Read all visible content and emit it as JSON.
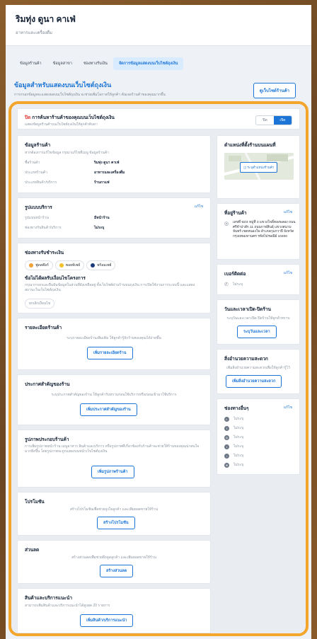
{
  "header": {
    "shop_name": "ริมทุ่ง ดูนา คาเฟ่",
    "shop_subtitle": "อาหารและเครื่องดื่ม"
  },
  "tabs": [
    {
      "label": "ข้อมูลร้านค้า"
    },
    {
      "label": "ข้อมูลสาขา"
    },
    {
      "label": "ช่องทางรับเงิน"
    },
    {
      "label": "จัดการข้อมูลแสดงบนเว็บไซต์ถุงเงิน",
      "active": true
    }
  ],
  "intro": {
    "title": "ข้อมูลสำหรับแสดงบนเว็บไซต์ถุงเงิน",
    "subtitle": "การกรอกข้อมูลจะแสดงผลบนเว็บไซต์ถุงเงิน จะช่วยเพิ่มโอกาสให้ลูกค้า ค้นเจอร้านค้าของคุณมากขึ้น",
    "preview_label": "ดูเว็บไซต์ร้านค้า"
  },
  "toggle": {
    "prefix": "ปิด",
    "title": "การค้นหาร้านค้าของคุณบนเว็บไซต์ถุงเงิน",
    "subtitle": "แสดงข้อมูลร้านค้าบนเว็บไซต์ถุงเงินให้ลูกค้าค้นหา",
    "off_label": "ปิด",
    "on_label": "เปิด"
  },
  "store_info": {
    "title": "ข้อมูลร้านค้า",
    "subtitle": "หากต้องการแก้ไขข้อมูล กรุณาแก้ไขที่เมนู ข้อมูลร้านค้า",
    "rows": [
      {
        "label": "ชื่อร้านค้า",
        "value": "ริมทุ่ง ดูนา คาเฟ่"
      },
      {
        "label": "ประเภทร้านค้า",
        "value": "อาหารและเครื่องดื่ม"
      },
      {
        "label": "ประเภทสินค้า/บริการ",
        "value": "ร้านกาแฟ"
      }
    ]
  },
  "service": {
    "title": "รูปแบบบริการ",
    "edit_label": "แก้ไข",
    "rows": [
      {
        "label": "รูปแบบหน้าร้าน",
        "value": "มีหน้าร้าน"
      },
      {
        "label": "ช่องทางรับสินค้า/บริการ",
        "value": "ไม่ระบุ"
      }
    ]
  },
  "payment": {
    "title": "ช่องทางรับชำระเงิน",
    "methods": [
      "ฟูดสต๊อร์",
      "พอยท์เพย์",
      "พร้อมเพย์"
    ],
    "conditions_title": "ข้อไม่ได้ผลรับเงื่อนไขโครงการ",
    "conditions_text": "กรุณากรอกและยืนยันข้อมูลในส่วนที่ยังเหลืออยู่ ทั้งเว็บไซต์ผ่านร้านบนถุงเงิน การเปิดใช้งานการระบบนี้ และแสดงสถานะในเว็บไซต์ถุงเงิน",
    "chip_label": "ยกเลิกเงื่อนไข"
  },
  "store_detail": {
    "title": "รายละเอียดร้านค้า",
    "hint": "ระบุรายละเอียดร้านเพิ่มเติม ให้ลูกค้ารู้จักร้านของคุณได้ง่ายขึ้น",
    "button": "เพิ่มรายละเอียดร้าน"
  },
  "announcement": {
    "title": "ประกาศสำคัญของร้าน",
    "hint": "ระบุประกาศสำคัญของร้าน ให้ลูกค้ารับทราบก่อนใช้บริการหรือก่อนเข้ามาใช้บริการ",
    "button": "เพิ่มประกาศสำคัญของร้าน"
  },
  "photos": {
    "title": "รูปภาพประกอบร้านค้า",
    "hint": "การเพิ่มรูปภาพหน้าร้าน เมนูอาหาร สินค้าและบริการ หรือรูปภาพที่เกี่ยวข้องกับร้านค้าจะช่วยให้ร้านของคุณน่าสนใจมากยิ่งขึ้น โดยรูปภาพจะถูกแสดงบนหน้าเว็บไซต์ถุงเงิน",
    "button": "เพิ่มรูปภาพร้านค้า"
  },
  "promo": {
    "title": "โปรโมชัน",
    "hint": "สร้างโปรโมชันเพื่อช่วยจูงใจลูกค้า และเพิ่มยอดขายให้ร้าน",
    "button": "สร้างโปรโมชัน"
  },
  "discount": {
    "title": "ส่วนลด",
    "hint": "สร้างส่วนลดเพื่อช่วยดึงดูดลูกค้า และเพิ่มยอดขายให้ร้าน",
    "button": "สร้างส่วนลด"
  },
  "recommend": {
    "title": "สินค้าและบริการแนะนำ",
    "hint": "สามารถเพิ่มสินค้าและบริการแนะนำได้สูงสุด 20 รายการ",
    "button": "เพิ่มสินค้า/บริการแนะนำ"
  },
  "map_card": {
    "title": "ตำแหน่งที่ตั้งร้านบนแผนที่",
    "button": "ระบุตำแหน่งร้านค้า"
  },
  "address": {
    "title": "ที่อยู่ร้านค้า",
    "edit_label": "แก้ไข",
    "text": "เลขที่ 92/4 หมู่ที่ 3 แขวงโพธิ์ทองพลอง ถนนศรีจำปาสัก 11 ถนนกาฬสินธุ์ แขวงสนามจันทร์ เขตหนองโพ อำเภอกุมภวาปี จังหวัดกรุงเทพมหานคร รหัสไปรษณีย์ 10400"
  },
  "phone": {
    "title": "เบอร์ติดต่อ",
    "edit_label": "แก้ไข",
    "value": "ไม่ระบุ"
  },
  "hours": {
    "title": "วันและเวลาเปิด-ปิดร้าน",
    "hint": "ระบุวันและเวลาเปิด-ปิดร้านให้ลูกค้าทราบ",
    "button": "ระบุวันและเวลา"
  },
  "facilities": {
    "title": "สิ่งอำนวยความสะดวก",
    "hint": "เพิ่มสิ่งอำนวยความสะดวกเพื่อให้ลูกค้ารู้ไว้",
    "button": "เพิ่มสิ่งอำนวยความสะดวก"
  },
  "channels": {
    "title": "ช่องทางอื่นๆ",
    "edit_label": "แก้ไข",
    "items": [
      {
        "icon": "line-icon",
        "value": "ไม่ระบุ"
      },
      {
        "icon": "facebook-icon",
        "value": "ไม่ระบุ"
      },
      {
        "icon": "instagram-icon",
        "value": "ไม่ระบุ"
      },
      {
        "icon": "twitter-icon",
        "value": "ไม่ระบุ"
      },
      {
        "icon": "tiktok-icon",
        "value": "ไม่ระบุ"
      },
      {
        "icon": "website-icon",
        "value": "ไม่ระบุ"
      }
    ]
  },
  "colors": {
    "accent": "#1c75d6",
    "highlight_ring": "#f4a52c",
    "off_red": "#e03c3c"
  }
}
